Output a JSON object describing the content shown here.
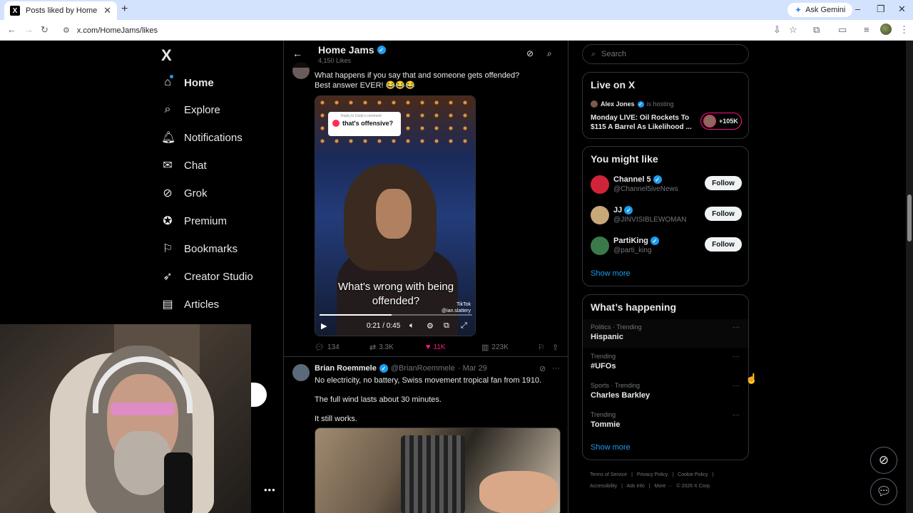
{
  "browser": {
    "tab_title": "Posts liked by Home Jams (@H",
    "tab_favicon": "X",
    "new_tab": "+",
    "gemini_label": "Ask Gemini",
    "url": "x.com/HomeJams/likes"
  },
  "nav": {
    "logo": "X",
    "items": [
      {
        "label": "Home",
        "icon": "home-icon"
      },
      {
        "label": "Explore",
        "icon": "search-icon"
      },
      {
        "label": "Notifications",
        "icon": "bell-icon"
      },
      {
        "label": "Chat",
        "icon": "mail-icon"
      },
      {
        "label": "Grok",
        "icon": "grok-icon"
      },
      {
        "label": "Premium",
        "icon": "premium-icon"
      },
      {
        "label": "Bookmarks",
        "icon": "bookmark-icon"
      },
      {
        "label": "Creator Studio",
        "icon": "rocket-icon"
      },
      {
        "label": "Articles",
        "icon": "article-icon"
      }
    ]
  },
  "feed": {
    "title": "Home Jams",
    "subtitle": "4,150 Likes",
    "post1": {
      "text_line1": "What happens if you say that and someone gets offended?",
      "text_line2": "Best answer EVER! 😂😂😂",
      "video": {
        "bubble_top": "Reply to Cody's comment",
        "bubble_text": "that's offensive?",
        "caption_line1": "What's wrong with being",
        "caption_line2": "offended?",
        "tiktok": "TikTok",
        "tiktok_handle": "@ian.slattery",
        "time": "0:21 / 0:45",
        "progress": 0.47
      },
      "replies": "134",
      "reposts": "3.3K",
      "likes": "11K",
      "views": "223K"
    },
    "post2": {
      "name": "Brian Roemmele",
      "handle": "@BrianRoemmele",
      "date": "· Mar 29",
      "line1": "No electricity, no battery, Swiss movement tropical fan from 1910.",
      "line2": "The full wind lasts about 30 minutes.",
      "line3": "It still works."
    }
  },
  "right": {
    "search_placeholder": "Search",
    "live": {
      "title": "Live on X",
      "host": "Alex Jones",
      "host_status": "is hosting",
      "space_title": "Monday LIVE: Oil Rockets To $115 A Barrel As Likelihood ...",
      "listeners": "+105K"
    },
    "suggest": {
      "title": "You might like",
      "users": [
        {
          "name": "Channel 5",
          "handle": "@Channel5iveNews",
          "color": "#d0243b"
        },
        {
          "name": "JJ",
          "handle": "@JINVISIBLEWOMAN",
          "color": "#c8a878"
        },
        {
          "name": "PartiKing",
          "handle": "@parti_king",
          "color": "#3a7a4a"
        }
      ],
      "follow_label": "Follow",
      "show_more": "Show more"
    },
    "trends": {
      "title": "What’s happening",
      "items": [
        {
          "context": "Politics · Trending",
          "topic": "Hispanic"
        },
        {
          "context": "Trending",
          "topic": "#UFOs"
        },
        {
          "context": "Sports · Trending",
          "topic": "Charles Barkley"
        },
        {
          "context": "Trending",
          "topic": "Tommie"
        }
      ],
      "show_more": "Show more"
    },
    "footer": {
      "row1": [
        "Terms of Service",
        "|",
        "Privacy Policy",
        "|",
        "Cookie Policy",
        "|"
      ],
      "row2": [
        "Accessibility",
        "|",
        "Ads info",
        "|",
        "More ···",
        "© 2026 X Corp."
      ]
    }
  },
  "colors": {
    "accent": "#1d9bf0",
    "like": "#f91880",
    "bg": "#000000",
    "border": "#2f3336"
  }
}
